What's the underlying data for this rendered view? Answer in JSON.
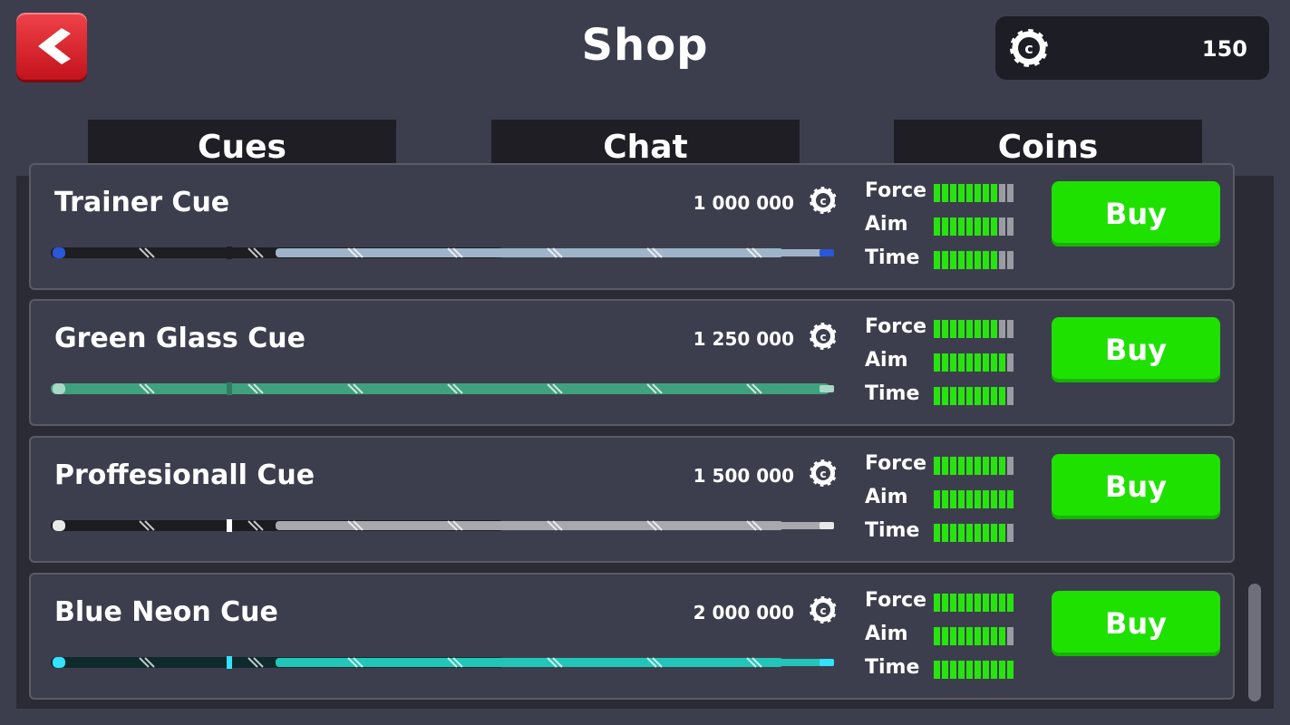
{
  "header": {
    "title": "Shop",
    "coins": "150"
  },
  "tabs": [
    {
      "label": "Cues"
    },
    {
      "label": "Chat"
    },
    {
      "label": "Coins"
    }
  ],
  "stat_labels": {
    "force": "Force",
    "aim": "Aim",
    "time": "Time"
  },
  "cues": [
    {
      "name": "Trainer Cue",
      "price": "1 000 000",
      "force": 8,
      "aim": 8,
      "time": 8,
      "max": 10,
      "buy_label": "Buy",
      "style": "trainer"
    },
    {
      "name": "Green Glass Cue",
      "price": "1 250 000",
      "force": 8,
      "aim": 9,
      "time": 9,
      "max": 10,
      "buy_label": "Buy",
      "style": "green"
    },
    {
      "name": "Proffesionall Cue",
      "price": "1 500 000",
      "force": 9,
      "aim": 10,
      "time": 9,
      "max": 10,
      "buy_label": "Buy",
      "style": "pro"
    },
    {
      "name": "Blue Neon Cue",
      "price": "2 000 000",
      "force": 10,
      "aim": 9,
      "time": 10,
      "max": 10,
      "buy_label": "Buy",
      "style": "neon"
    }
  ],
  "colors": {
    "background": "#3d3e4d",
    "buy_button": "#1fe100",
    "stat_bar_on": "#27e40f",
    "stat_bar_off": "#9b9ba3",
    "back_button": "#d7161f"
  },
  "icons": {
    "back": "chevron-left-icon",
    "coin": "coin-chip-icon"
  }
}
